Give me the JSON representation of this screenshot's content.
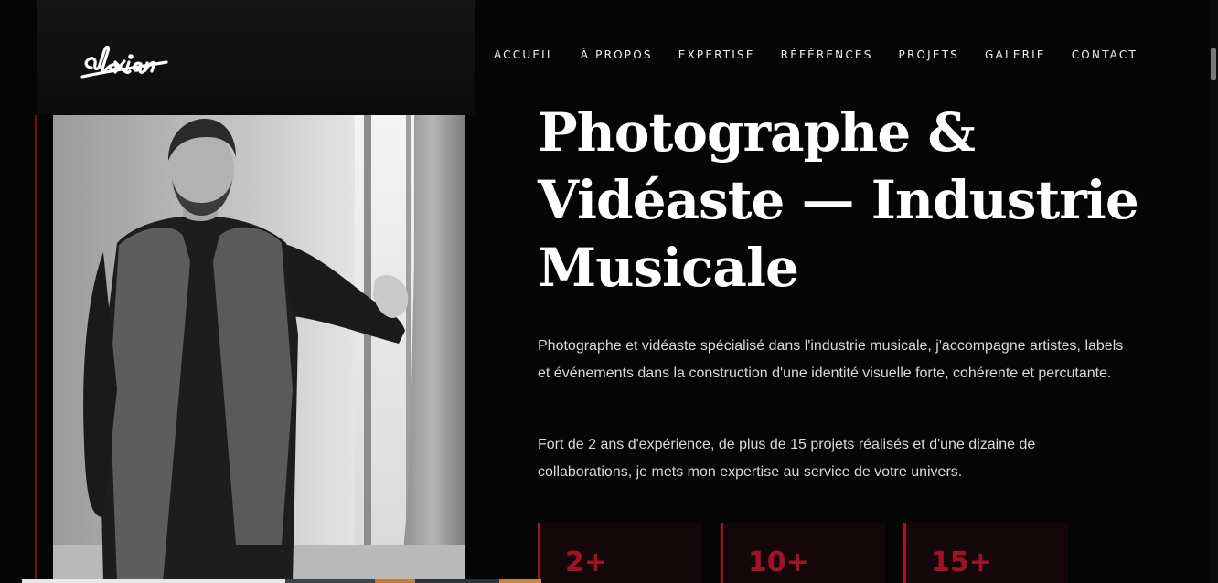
{
  "brand": {
    "logo_text": "alexian"
  },
  "nav": {
    "items": [
      {
        "label": "ACCUEIL"
      },
      {
        "label": "À PROPOS"
      },
      {
        "label": "EXPERTISE"
      },
      {
        "label": "RÉFÉRENCES"
      },
      {
        "label": "PROJETS"
      },
      {
        "label": "GALERIE"
      },
      {
        "label": "CONTACT"
      }
    ]
  },
  "hero": {
    "title_line1": "Photographe &",
    "title_line2": "Vidéaste — Industrie",
    "title_line3": "Musicale",
    "paragraph1": "Photographe et vidéaste spécialisé dans l'industrie musicale, j'accompagne artistes, labels et événements dans la construction d'une identité visuelle forte, cohérente et percutante.",
    "paragraph2": "Fort de 2 ans d'expérience, de plus de 15 projets réalisés et d'une dizaine de collaborations, je mets mon expertise au service de votre univers."
  },
  "stats": [
    {
      "value": "2+"
    },
    {
      "value": "10+"
    },
    {
      "value": "15+"
    }
  ],
  "colors": {
    "background": "#050505",
    "accent": "#a51224",
    "stat_background": "#140709",
    "text": "#ffffff"
  }
}
